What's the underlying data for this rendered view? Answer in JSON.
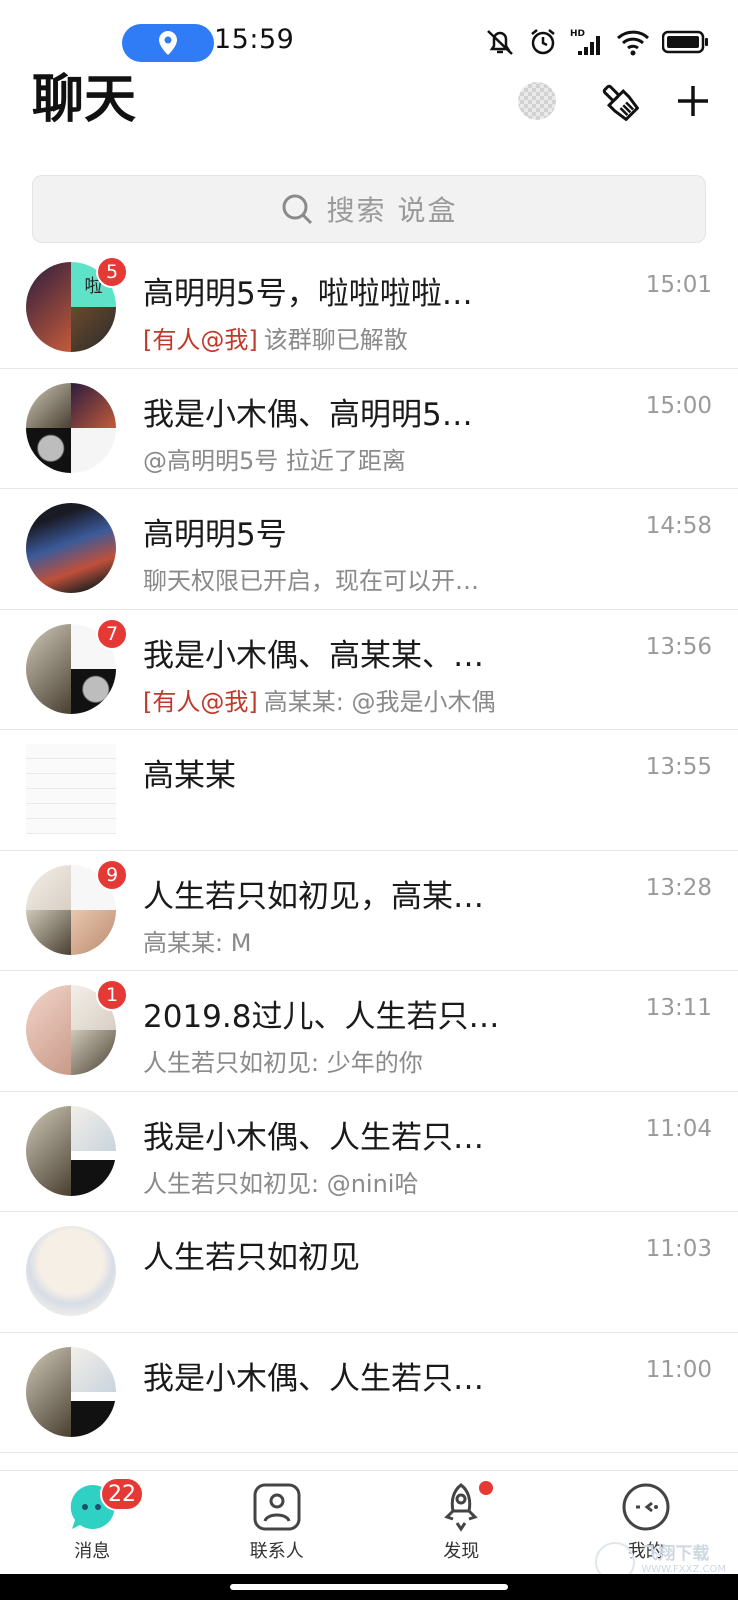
{
  "status_bar": {
    "time": "15:59"
  },
  "header": {
    "title": "聊天"
  },
  "search": {
    "placeholder": "搜索 说盒"
  },
  "chats": [
    {
      "name": "高明明5号，啦啦啦啦…",
      "time": "15:01",
      "mention": "[有人@我]",
      "preview": "该群聊已解散",
      "badge": "5",
      "avatar_label": "啦"
    },
    {
      "name": "我是小木偶、高明明5…",
      "time": "15:00",
      "mention": "",
      "preview": "@高明明5号 拉近了距离",
      "badge": ""
    },
    {
      "name": "高明明5号",
      "time": "14:58",
      "mention": "",
      "preview": "聊天权限已开启，现在可以开…",
      "badge": ""
    },
    {
      "name": "我是小木偶、高某某、…",
      "time": "13:56",
      "mention": "[有人@我]",
      "preview": "高某某: @我是小木偶",
      "badge": "7"
    },
    {
      "name": "高某某",
      "time": "13:55",
      "mention": "",
      "preview": "",
      "badge": ""
    },
    {
      "name": "人生若只如初见，高某…",
      "time": "13:28",
      "mention": "",
      "preview": "高某某: M",
      "badge": "9"
    },
    {
      "name": "2019.8过儿、人生若只…",
      "time": "13:11",
      "mention": "",
      "preview": "人生若只如初见: 少年的你",
      "badge": "1"
    },
    {
      "name": "我是小木偶、人生若只…",
      "time": "11:04",
      "mention": "",
      "preview": "人生若只如初见: @nini哈",
      "badge": ""
    },
    {
      "name": "人生若只如初见",
      "time": "11:03",
      "mention": "",
      "preview": "",
      "badge": ""
    },
    {
      "name": "我是小木偶、人生若只…",
      "time": "11:00",
      "mention": "",
      "preview": "",
      "badge": ""
    }
  ],
  "bottom_nav": {
    "messages": {
      "label": "消息",
      "badge": "22"
    },
    "contacts": {
      "label": "联系人"
    },
    "discover": {
      "label": "发现"
    },
    "me": {
      "label": "我的"
    }
  },
  "watermark": {
    "main": "飞翔下载",
    "sub": "WWW.FXXZ.COM"
  },
  "colors": {
    "accent_blue": "#2f7cf6",
    "badge_red": "#e53935",
    "mention_red": "#c0392b",
    "nav_teal": "#2ed1c4"
  }
}
